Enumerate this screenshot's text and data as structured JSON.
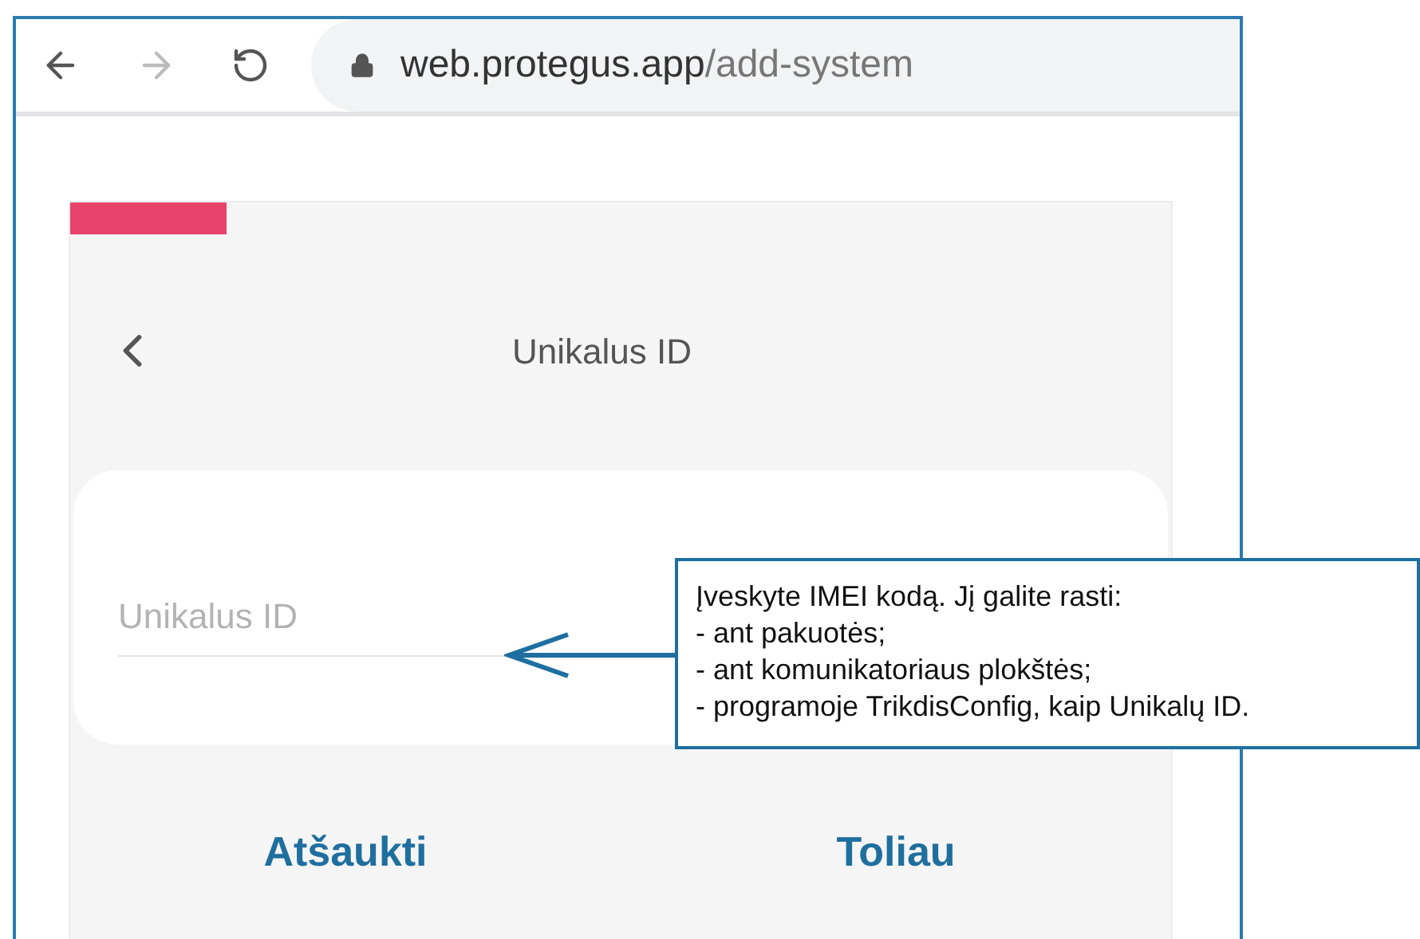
{
  "browser": {
    "url_host": "web.protegus.app",
    "url_path": "/add-system"
  },
  "page": {
    "title": "Unikalus ID",
    "input": {
      "placeholder": "Unikalus ID"
    },
    "buttons": [
      "Atšaukti",
      "Toliau"
    ]
  },
  "callout": {
    "lines": [
      "Įveskyte IMEI kodą. Jį galite rasti:",
      "- ant pakuotės;",
      "- ant komunikatoriaus plokštės;",
      "- programoje TrikdisConfig, kaip Unikalų ID."
    ]
  }
}
